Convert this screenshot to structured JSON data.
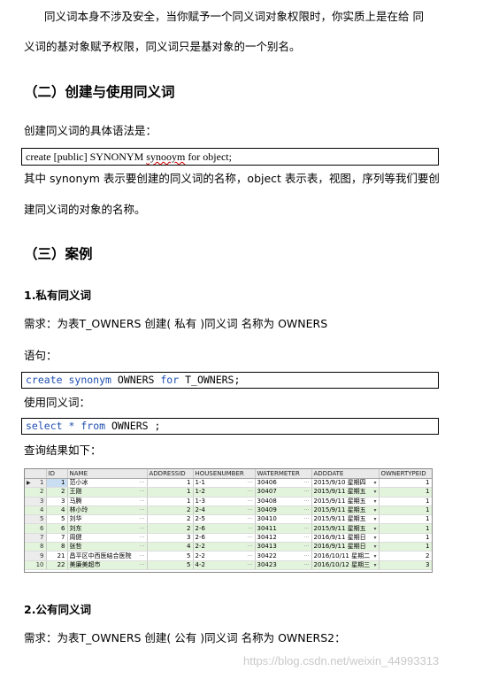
{
  "doc": {
    "para1_line1": "同义词本身不涉及安全，当你赋予一个同义词对象权限时，你实质上是在给 同",
    "para1_line2": "义词的基对象赋予权限，同义词只是基对象的一个别名。",
    "heading2": "（二）创建与使用同义词",
    "syntax_intro": "创建同义词的具体语法是：",
    "syntax_pre": "create [public] SYNONYM ",
    "syntax_word": "synooym",
    "syntax_post": " for object;",
    "explain_line1": "其中 synonym 表示要创建的同义词的名称，object 表示表，视图，序列等我们要创",
    "explain_line2": "建同义词的对象的名称。",
    "heading3": "（三）案例",
    "sub1": "1.私有同义词",
    "req1": "需求：为表T_OWNERS 创建( 私有 )同义词 名称为 OWNERS",
    "stmt_label": "语句：",
    "code1": {
      "k1": "create",
      "k2": "synonym",
      "name": "OWNERS",
      "k3": "for",
      "target": "T_OWNERS;"
    },
    "use_label": "使用同义词：",
    "code2": {
      "k1": "select",
      "star": "*",
      "k2": "from",
      "name": "OWNERS",
      "end": ";"
    },
    "result_label": "查询结果如下：",
    "sub2": "2.公有同义词",
    "req2": "需求：为表T_OWNERS 创建( 公有 )同义词 名称为 OWNERS2："
  },
  "grid": {
    "columns": [
      "",
      "ID",
      "NAME",
      "ADDRESSID",
      "HOUSENUMBER",
      "WATERMETER",
      "ADDDATE",
      "OWNERTYPEID"
    ],
    "rows": [
      [
        "1",
        "1",
        "范小冰",
        "1",
        "1-1",
        "30406",
        "2015/9/10 星期四",
        "1"
      ],
      [
        "2",
        "2",
        "王刚",
        "1",
        "1-2",
        "30407",
        "2015/9/11 星期五",
        "1"
      ],
      [
        "3",
        "3",
        "马腾",
        "1",
        "1-3",
        "30408",
        "2015/9/11 星期五",
        "1"
      ],
      [
        "4",
        "4",
        "林小玲",
        "2",
        "2-4",
        "30409",
        "2015/9/11 星期五",
        "1"
      ],
      [
        "5",
        "5",
        "刘华",
        "2",
        "2-5",
        "30410",
        "2015/9/11 星期五",
        "1"
      ],
      [
        "6",
        "6",
        "刘东",
        "2",
        "2-6",
        "30411",
        "2015/9/11 星期五",
        "1"
      ],
      [
        "7",
        "7",
        "周健",
        "3",
        "2-6",
        "30412",
        "2016/9/11 星期日",
        "1"
      ],
      [
        "8",
        "8",
        "张哲",
        "4",
        "2-2",
        "30413",
        "2016/9/11 星期日",
        "1"
      ],
      [
        "9",
        "21",
        "昌平区中西医结合医院",
        "5",
        "2-2",
        "30422",
        "2016/10/11 星期二",
        "2"
      ],
      [
        "10",
        "22",
        "美廉美超市",
        "5",
        "4-2",
        "30423",
        "2016/10/12 星期三",
        "3"
      ]
    ]
  },
  "watermark": "https://blog.csdn.net/weixin_44993313"
}
